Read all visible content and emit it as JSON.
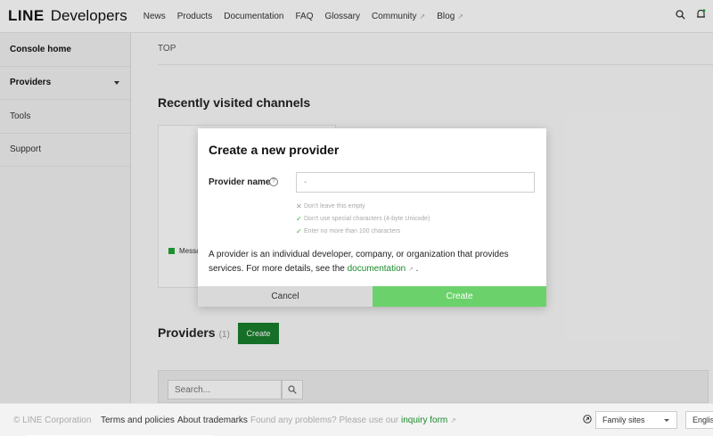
{
  "header": {
    "logo_main": "LINE",
    "logo_sub": "Developers",
    "nav": [
      {
        "label": "News",
        "external": false
      },
      {
        "label": "Products",
        "external": false
      },
      {
        "label": "Documentation",
        "external": false
      },
      {
        "label": "FAQ",
        "external": false
      },
      {
        "label": "Glossary",
        "external": false
      },
      {
        "label": "Community",
        "external": true
      },
      {
        "label": "Blog",
        "external": true
      }
    ],
    "icons": [
      "search-icon",
      "bell-icon"
    ]
  },
  "sidebar": {
    "items": [
      {
        "label": "Console home",
        "bold": true
      },
      {
        "label": "Providers",
        "bold": true
      },
      {
        "label": "Tools",
        "bold": false
      },
      {
        "label": "Support",
        "bold": false
      }
    ]
  },
  "main": {
    "breadcrumb": "TOP",
    "recent_heading": "Recently visited channels",
    "card_tag": "Messa",
    "providers_heading": "Providers",
    "providers_count": "(1)",
    "create_button": "Create",
    "search_placeholder": "Search..."
  },
  "footer": {
    "copyright": "© LINE Corporation",
    "terms": "Terms and policies",
    "trademarks": "About trademarks",
    "help_text": "Found any problems? Please use our",
    "inquiry_link": "inquiry form",
    "family_sites": "Family sites",
    "language": "English"
  },
  "modal": {
    "title": "Create a new provider",
    "field_label": "Provider name",
    "field_value": "-",
    "rules": [
      {
        "text": "Don't leave this empty",
        "status": "fail"
      },
      {
        "text": "Don't use special characters (4-byte Unicode)",
        "status": "pass"
      },
      {
        "text": "Enter no more than 100 characters",
        "status": "pass"
      }
    ],
    "description": "A provider is an individual developer, company, or organization that provides services. For more details, see the",
    "doc_link": "documentation",
    "desc_end": ".",
    "cancel_label": "Cancel",
    "create_label": "Create"
  },
  "colors": {
    "accent_green": "#1a7f2c",
    "create_green": "#6bd26b",
    "link_green": "#1a8a2b"
  }
}
